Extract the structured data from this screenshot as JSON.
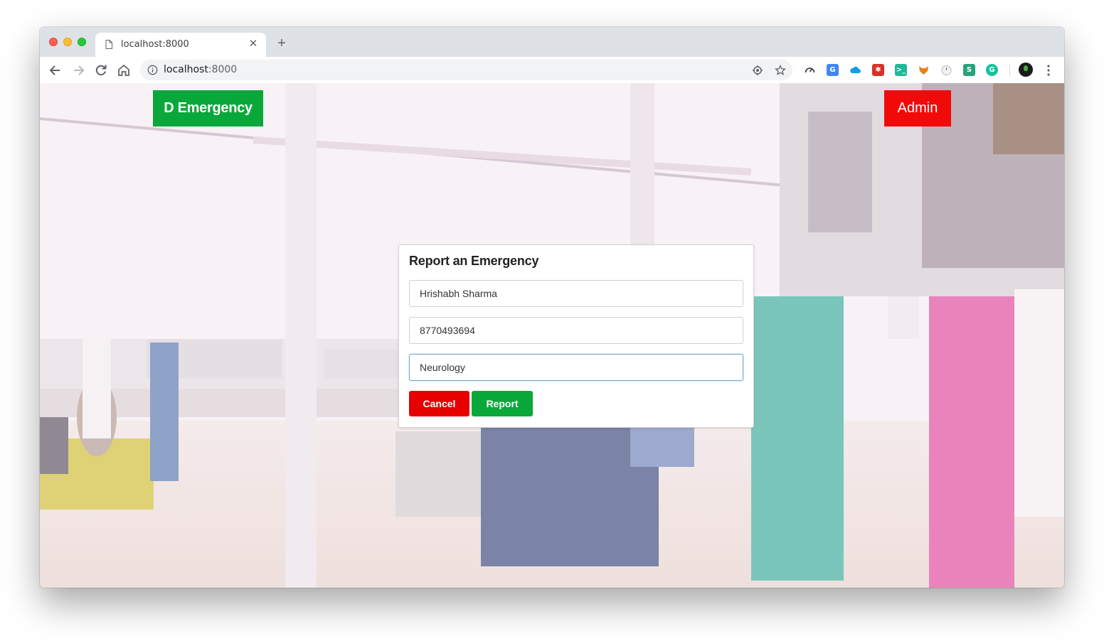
{
  "browser": {
    "tab_title": "localhost:8000",
    "url_host": "localhost",
    "url_port": ":8000"
  },
  "page": {
    "brand_label": "D Emergency",
    "admin_label": "Admin"
  },
  "form": {
    "title": "Report an Emergency",
    "name_value": "Hrishabh Sharma",
    "phone_value": "8770493694",
    "department_value": "Neurology",
    "cancel_label": "Cancel",
    "report_label": "Report"
  },
  "colors": {
    "brand_green": "#0aa83a",
    "admin_red": "#f20a0a",
    "cancel_red": "#e60000"
  },
  "icons": [
    "back-arrow-icon",
    "forward-arrow-icon",
    "reload-icon",
    "home-icon",
    "info-icon",
    "location-icon",
    "star-icon",
    "more-vert-icon"
  ]
}
